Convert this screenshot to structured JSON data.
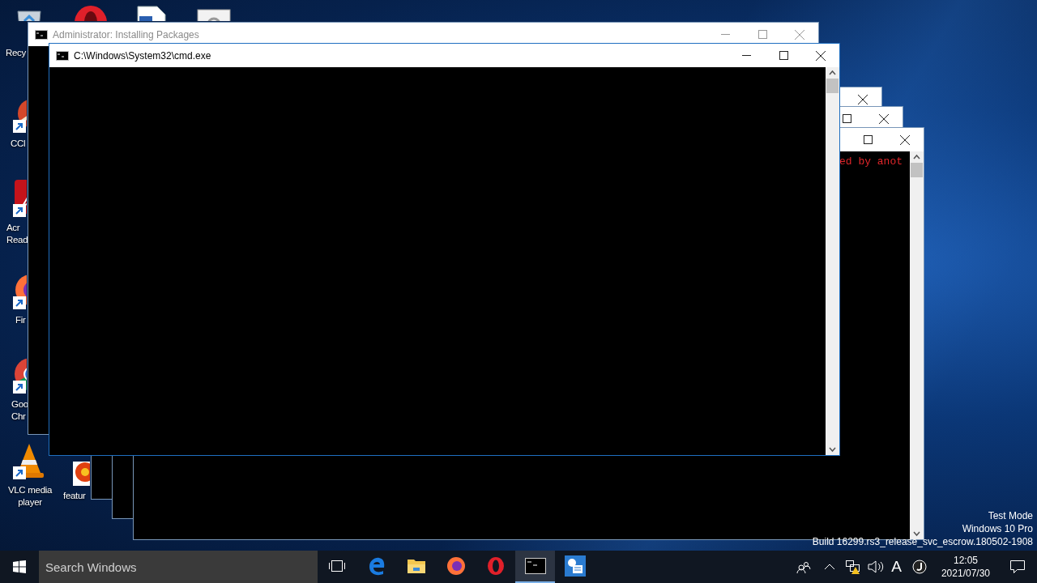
{
  "desktop_icons": [
    {
      "kind": "recycle-bin",
      "label": "Recy"
    },
    {
      "kind": "opera"
    },
    {
      "kind": "document"
    },
    {
      "kind": "settings-document"
    },
    {
      "kind": "ccleaner",
      "label": "CCl",
      "shortcut": true
    },
    {
      "kind": "acrobat",
      "label": "Acr\nRead",
      "shortcut": true
    },
    {
      "kind": "firefox",
      "label": "Fir",
      "shortcut": true
    },
    {
      "kind": "chrome",
      "label": "Goo\nChr",
      "shortcut": true
    },
    {
      "kind": "vlc",
      "label": "VLC media\nplayer",
      "shortcut": true
    },
    {
      "kind": "image-file",
      "label": "featur",
      "shortcut": false
    }
  ],
  "windows": [
    {
      "kind": "console",
      "buttons": [
        {
          "kind": "close"
        }
      ]
    },
    {
      "kind": "console",
      "buttons": [
        {
          "kind": "maximize"
        },
        {
          "kind": "close"
        }
      ]
    },
    {
      "kind": "console",
      "buttons": [
        {
          "kind": "maximize"
        },
        {
          "kind": "close"
        }
      ],
      "scrollbar": true,
      "text": "ed by anot"
    },
    {
      "kind": "console",
      "title": "Administrator:  Installing Packages",
      "active": false,
      "buttons": [
        {
          "kind": "minimize"
        },
        {
          "kind": "maximize"
        },
        {
          "kind": "close"
        }
      ]
    },
    {
      "kind": "console",
      "title": "C:\\Windows\\System32\\cmd.exe",
      "active": true,
      "buttons": [
        {
          "kind": "minimize"
        },
        {
          "kind": "maximize"
        },
        {
          "kind": "close"
        }
      ],
      "scrollbar": true
    }
  ],
  "desktop_info": [
    "Test Mode",
    "Windows 10 Pro",
    "Build 16299.rs3_release_svc_escrow.180502-1908"
  ],
  "taskbar": {
    "search": {
      "placeholder": "Search Windows"
    },
    "apps": [
      {
        "kind": "task-view",
        "selected": false
      },
      {
        "kind": "edge",
        "selected": false
      },
      {
        "kind": "explorer",
        "selected": false
      },
      {
        "kind": "firefox",
        "selected": false
      },
      {
        "kind": "opera",
        "selected": false
      },
      {
        "kind": "console",
        "selected": true
      },
      {
        "kind": "settings-app",
        "selected": false
      }
    ],
    "tray": {
      "input_indicator": "A",
      "time": "12:05",
      "date": "2021/07/30"
    }
  }
}
